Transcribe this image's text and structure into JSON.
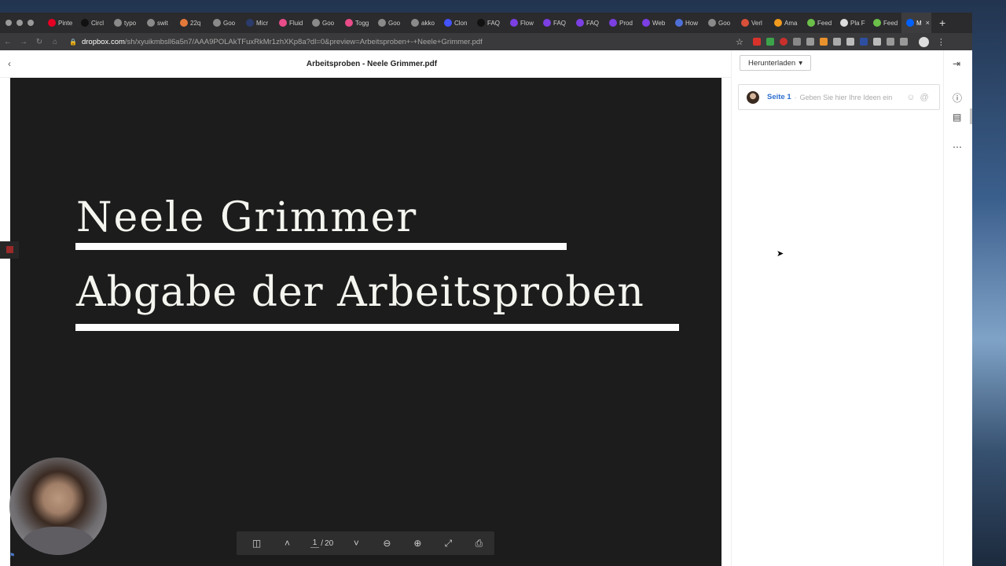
{
  "browser": {
    "tabs": [
      {
        "label": "Pinte",
        "icon": "pinterest-icon",
        "color": "#e60023"
      },
      {
        "label": "Circl",
        "icon": "circle-icon",
        "color": "#111111"
      },
      {
        "label": "typo",
        "icon": "google-icon",
        "color": "#8a8a8a"
      },
      {
        "label": "swit",
        "icon": "google-icon",
        "color": "#8a8a8a"
      },
      {
        "label": "22q",
        "icon": "globe-icon",
        "color": "#e5793a"
      },
      {
        "label": "Goo",
        "icon": "google-icon",
        "color": "#8a8a8a"
      },
      {
        "label": "Micr",
        "icon": "microsoft-icon",
        "color": "#2b3b6b"
      },
      {
        "label": "Fluid",
        "icon": "dribbble-icon",
        "color": "#ea4c89"
      },
      {
        "label": "Goo",
        "icon": "google-icon",
        "color": "#8a8a8a"
      },
      {
        "label": "Togg",
        "icon": "dribbble-icon",
        "color": "#ea4c89"
      },
      {
        "label": "Goo",
        "icon": "google-icon",
        "color": "#8a8a8a"
      },
      {
        "label": "akko",
        "icon": "google-icon",
        "color": "#8a8a8a"
      },
      {
        "label": "Clon",
        "icon": "webflow-icon",
        "color": "#4353ff"
      },
      {
        "label": "FAQ",
        "icon": "wix-icon",
        "color": "#111111"
      },
      {
        "label": "Flow",
        "icon": "framer-icon",
        "color": "#7b3fe4"
      },
      {
        "label": "FAQ",
        "icon": "framer-icon",
        "color": "#7b3fe4"
      },
      {
        "label": "FAQ",
        "icon": "framer-icon",
        "color": "#7b3fe4"
      },
      {
        "label": "Prod",
        "icon": "framer-icon",
        "color": "#7b3fe4"
      },
      {
        "label": "Web",
        "icon": "framer-icon",
        "color": "#7b3fe4"
      },
      {
        "label": "How",
        "icon": "doc-icon",
        "color": "#4f6fd8"
      },
      {
        "label": "Goo",
        "icon": "google-icon",
        "color": "#8a8a8a"
      },
      {
        "label": "Verl",
        "icon": "clock-icon",
        "color": "#d9503a"
      },
      {
        "label": "Ama",
        "icon": "amazon-icon",
        "color": "#f29b1e"
      },
      {
        "label": "Feed",
        "icon": "feedly-icon",
        "color": "#6cc04a"
      },
      {
        "label": "Pla F",
        "icon": "app-icon",
        "color": "#dddddd"
      },
      {
        "label": "Feed",
        "icon": "feedly-icon",
        "color": "#6cc04a"
      },
      {
        "label": "M",
        "icon": "dropbox-icon",
        "color": "#0061fe"
      }
    ],
    "new_tab": "+",
    "url_host": "dropbox.com",
    "url_path": "/sh/xyuikmbsll6a5n7/AAA9POLAkTFuxRkMr1zhXKp8a?dl=0&preview=Arbeitsproben+-+Neele+Grimmer.pdf"
  },
  "viewer": {
    "doc_title": "Arbeitsproben - Neele Grimmer.pdf",
    "slide_title": "Neele Grimmer",
    "slide_subtitle": "Abgabe der Arbeitsproben",
    "page_current": "1",
    "page_separator": "/",
    "page_total": "20"
  },
  "sidebar": {
    "download_label": "Herunterladen",
    "comment_page": "Seite 1",
    "comment_separator": "·",
    "comment_placeholder": "Geben Sie hier Ihre Ideen ein"
  },
  "colors": {
    "slide_background": "#1c1c1c",
    "link_blue": "#2f6fd0"
  }
}
